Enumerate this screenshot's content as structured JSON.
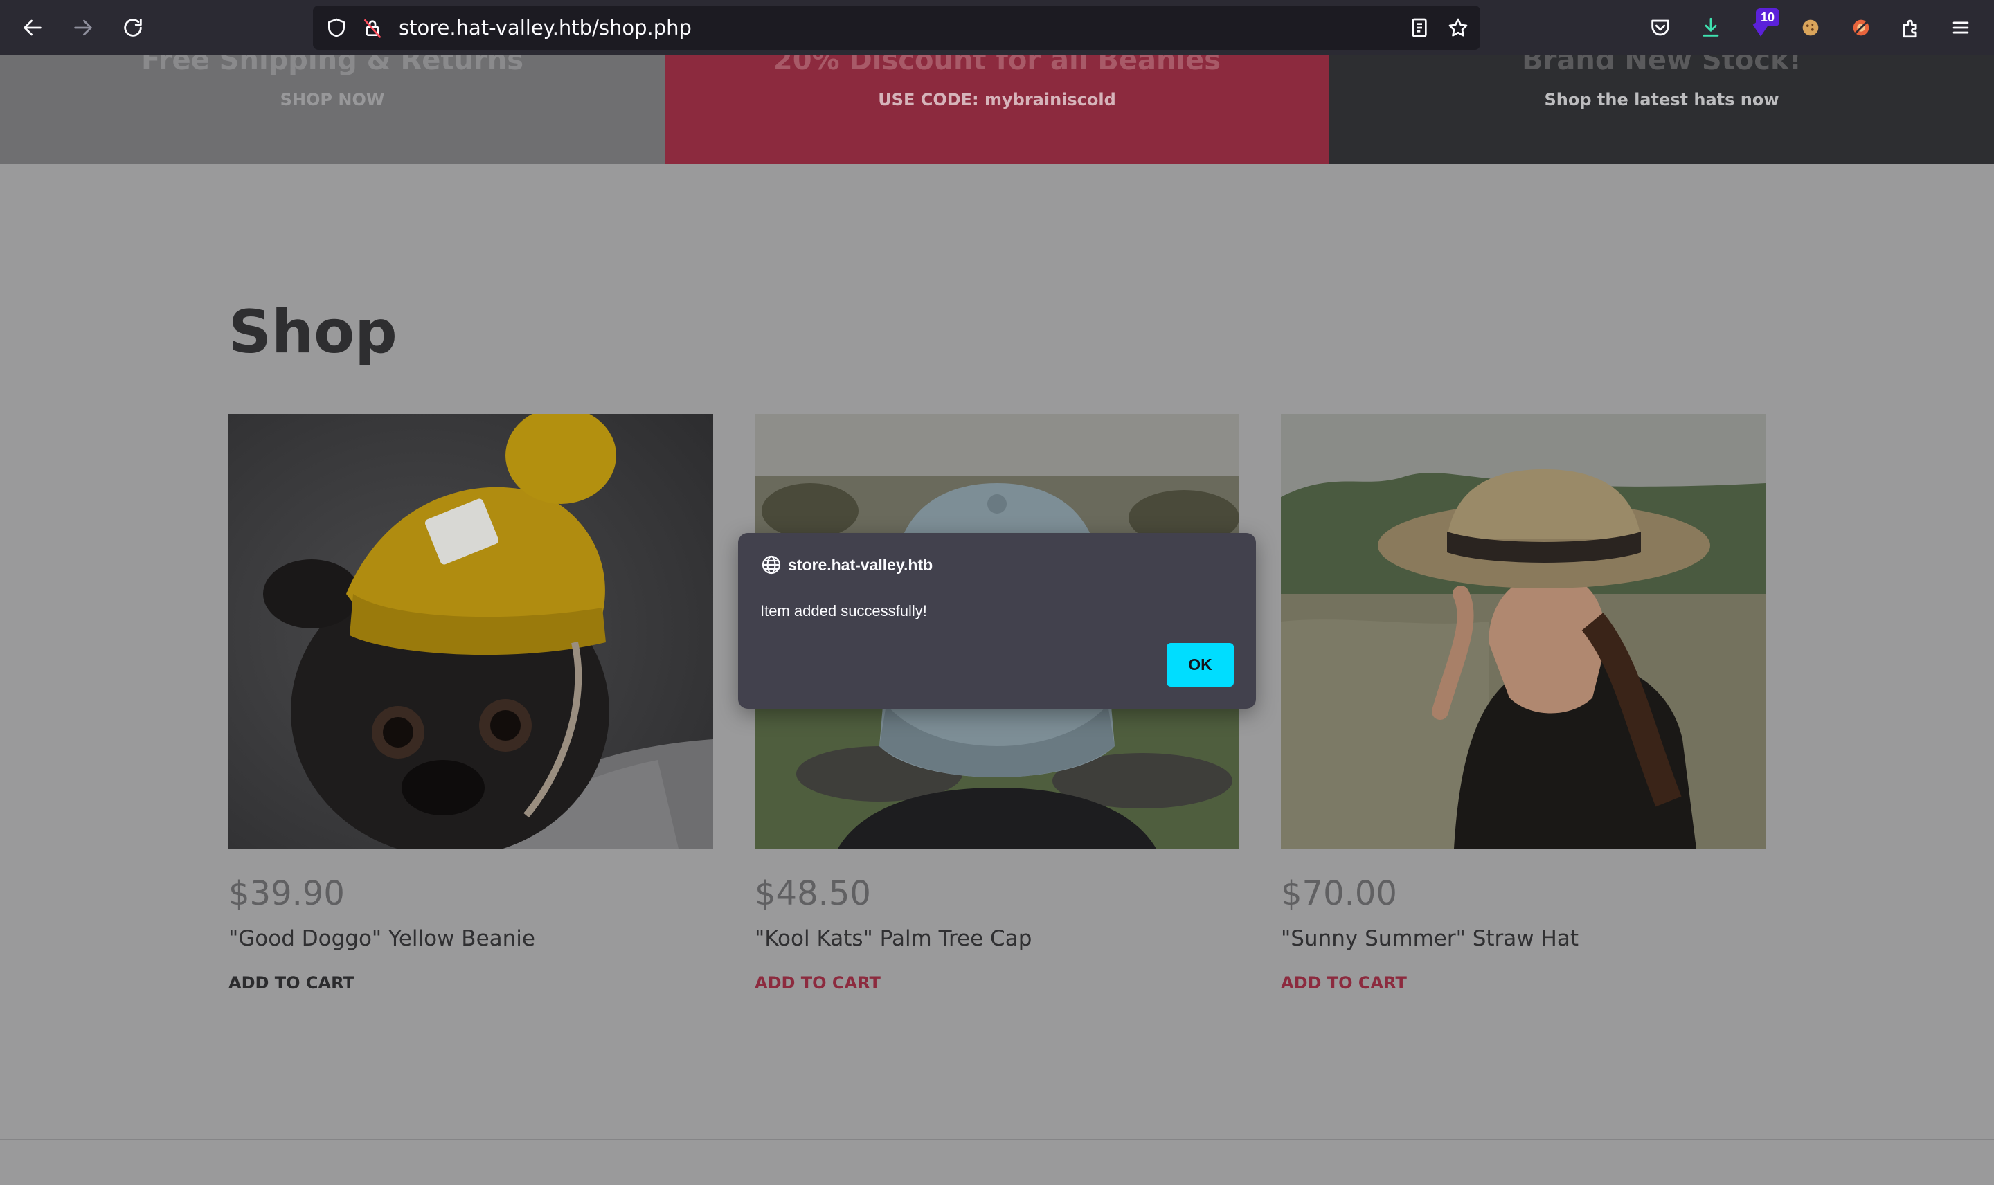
{
  "browser": {
    "url": "store.hat-valley.htb/shop.php",
    "extension_badge": "10"
  },
  "banners": [
    {
      "title": "Free Shipping & Returns",
      "subtitle": "SHOP NOW",
      "bg": "#6f6f71"
    },
    {
      "title": "20% Discount for all Beanies",
      "subtitle": "USE CODE: mybrainiscold",
      "bg": "#8c2a3e"
    },
    {
      "title": "Brand New Stock!",
      "subtitle": "Shop the latest hats now",
      "bg": "#2d2e31"
    }
  ],
  "shop": {
    "title": "Shop",
    "products": [
      {
        "price": "$39.90",
        "name": "\"Good Doggo\" Yellow Beanie",
        "cta": "ADD TO CART",
        "cta_color": "#2b2b2d"
      },
      {
        "price": "$48.50",
        "name": "\"Kool Kats\" Palm Tree Cap",
        "cta": "ADD TO CART",
        "cta_color": "#8c2a3e"
      },
      {
        "price": "$70.00",
        "name": "\"Sunny Summer\" Straw Hat",
        "cta": "ADD TO CART",
        "cta_color": "#8c2a3e"
      }
    ]
  },
  "dialog": {
    "host": "store.hat-valley.htb",
    "message": "Item added successfully!",
    "ok_label": "OK"
  },
  "colors": {
    "accent": "#00ddff",
    "brand_red": "#8c2a3e"
  }
}
